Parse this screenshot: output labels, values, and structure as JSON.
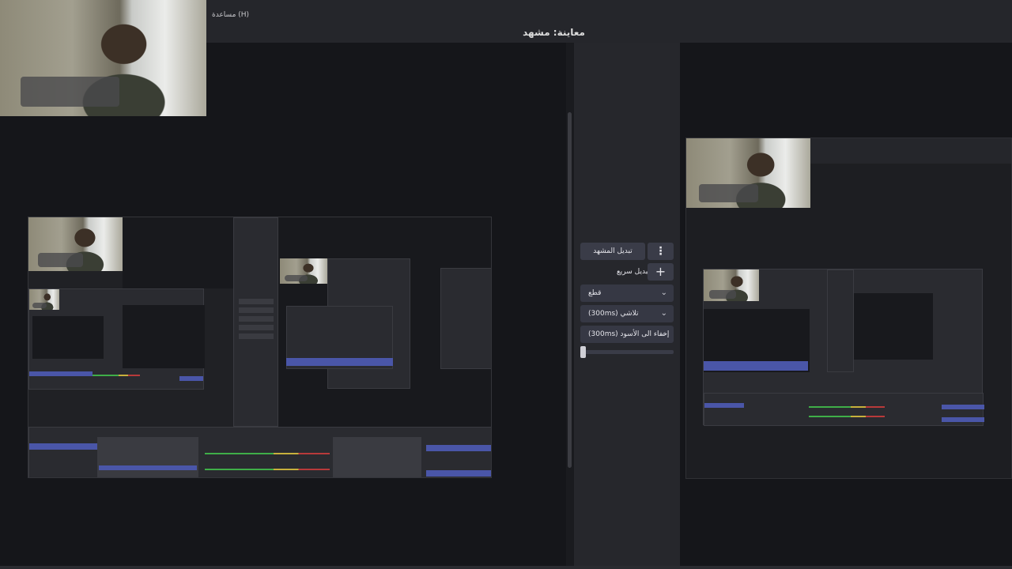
{
  "menu": {
    "help": "مساعدة (H)"
  },
  "preview": {
    "title": "معاينة: مشهد"
  },
  "transitions": {
    "switch_scene": "تبديل المشهد",
    "quick_transition": "تبديل سريع",
    "cut": "قطع",
    "fade": "(300ms) تلاشي",
    "fade_to_black": "(300ms) إخفاء الى الأسود"
  },
  "nested_left": {
    "switch_scene": "تبديل المشهد",
    "quick": "تبديل سريع",
    "cut": "قطع",
    "fade": "تلاشي",
    "fade_black": "إخفاء الى الأسود"
  },
  "icons": {
    "more": "vertical-dots-icon",
    "add": "plus-icon",
    "dropdown": "chevron-down-icon"
  },
  "colors": {
    "accent_blue": "#4a56a8",
    "panel_bg": "#26272c",
    "canvas_bg": "#15161a"
  }
}
